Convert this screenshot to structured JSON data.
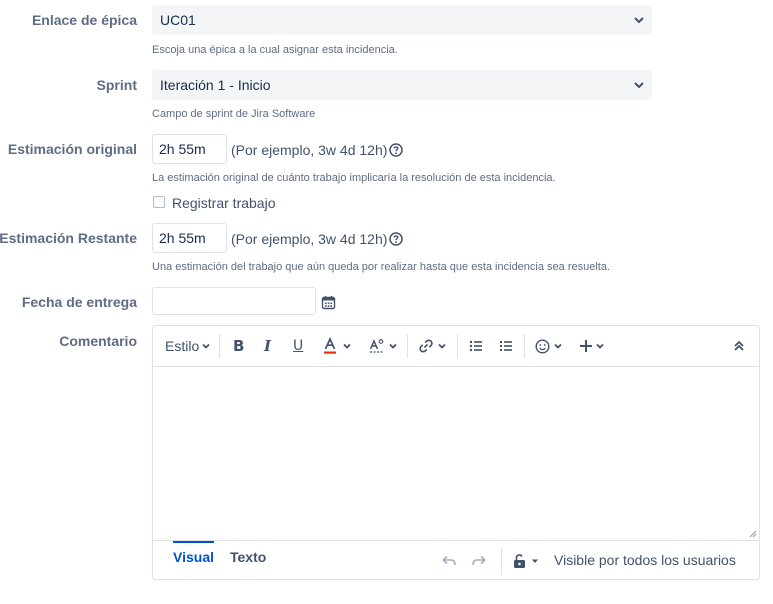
{
  "fields": {
    "epic": {
      "label": "Enlace de épica",
      "value": "UC01",
      "help": "Escoja una épica a la cual asignar esta incidencia."
    },
    "sprint": {
      "label": "Sprint",
      "value": "Iteración 1 - Inicio",
      "help": "Campo de sprint de Jira Software"
    },
    "original_estimate": {
      "label": "Estimación original",
      "value": "2h 55m",
      "example": "(Por ejemplo, 3w 4d 12h)",
      "help": "La estimación original de cuánto trabajo implicaría la resolución de esta incidencia."
    },
    "log_work": {
      "label": "Registrar trabajo",
      "checked": false
    },
    "remaining_estimate": {
      "label": "Estimación Restante",
      "value": "2h 55m",
      "example": "(Por ejemplo, 3w 4d 12h)",
      "help": "Una estimación del trabajo que aún queda por realizar hasta que esta incidencia sea resuelta."
    },
    "due_date": {
      "label": "Fecha de entrega",
      "value": ""
    },
    "comment": {
      "label": "Comentario",
      "value": ""
    }
  },
  "editor": {
    "toolbar": {
      "style_label": "Estilo",
      "icons": [
        "bold-icon",
        "italic-icon",
        "underline-icon",
        "text-color-icon",
        "more-formatting-icon",
        "link-icon",
        "bullet-list-icon",
        "numbered-list-icon",
        "emoji-icon",
        "insert-more-icon",
        "collapse-toolbar-icon"
      ]
    },
    "tabs": [
      "Visual",
      "Texto"
    ],
    "active_tab": "Visual",
    "visibility": "Visible por todos los usuarios"
  },
  "colors": {
    "accent": "#0052cc",
    "text_color_underline": "#de350b",
    "label": "#5e6c84"
  }
}
